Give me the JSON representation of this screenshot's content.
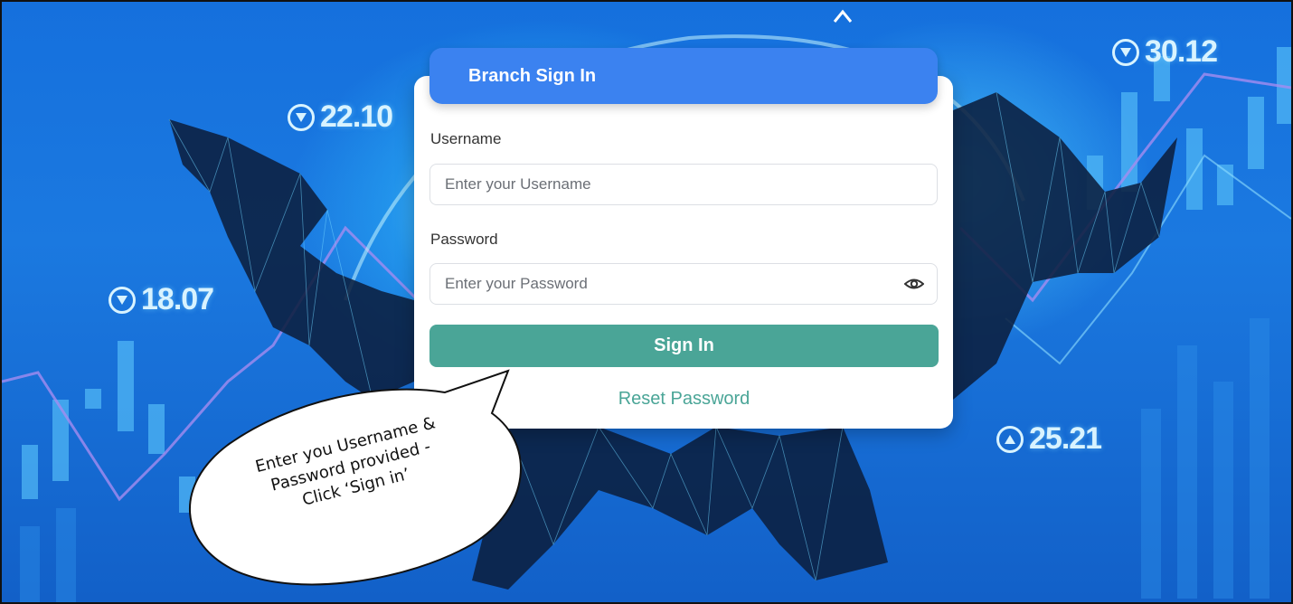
{
  "tickers": [
    {
      "direction": "down",
      "value": "22.10"
    },
    {
      "direction": "down",
      "value": "18.07"
    },
    {
      "direction": "down",
      "value": "30.12"
    },
    {
      "direction": "up",
      "value": "25.21"
    }
  ],
  "login": {
    "title": "Branch Sign In",
    "username_label": "Username",
    "username_placeholder": "Enter your Username",
    "password_label": "Password",
    "password_placeholder": "Enter your Password",
    "signin_label": "Sign In",
    "reset_label": "Reset Password",
    "eye_icon": "eye-icon"
  },
  "callout": {
    "lines": [
      "Enter you Username &",
      "Password provided -",
      "Click ‘Sign in’"
    ]
  },
  "colors": {
    "header": "#3b82f0",
    "button": "#4aa597",
    "link": "#4aa597",
    "background": "#1a72d8"
  }
}
